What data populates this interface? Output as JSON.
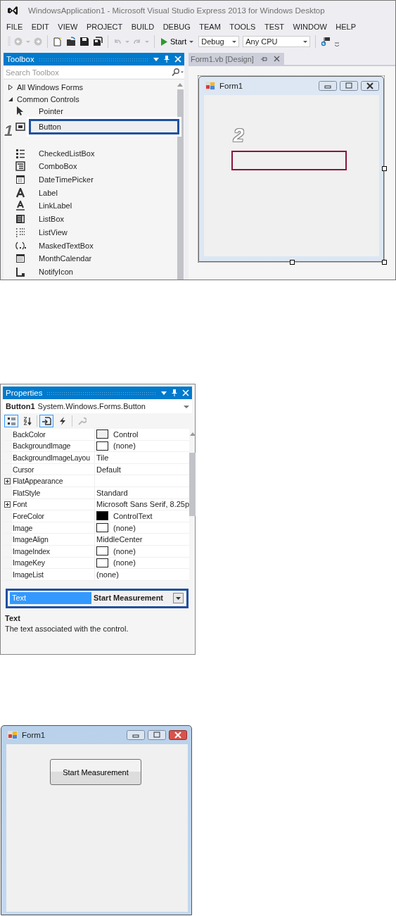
{
  "ide": {
    "title": "WindowsApplication1 - Microsoft Visual Studio Express 2013 for Windows Desktop",
    "menu": [
      "FILE",
      "EDIT",
      "VIEW",
      "PROJECT",
      "BUILD",
      "DEBUG",
      "TEAM",
      "TOOLS",
      "TEST",
      "WINDOW",
      "HELP"
    ],
    "toolbar": {
      "start": "Start",
      "configuration": "Debug",
      "platform": "Any CPU"
    },
    "toolbox": {
      "title": "Toolbox",
      "search_placeholder": "Search Toolbox",
      "callout": "1",
      "groups": [
        {
          "label": "All Windows Forms",
          "expanded": false
        },
        {
          "label": "Common Controls",
          "expanded": true
        }
      ],
      "items": [
        {
          "label": "Pointer",
          "kind": "pointer",
          "highlighted": false
        },
        {
          "label": "Button",
          "kind": "button",
          "highlighted": true
        },
        {
          "label": "CheckedListBox",
          "kind": "checkedlist",
          "highlighted": false
        },
        {
          "label": "ComboBox",
          "kind": "combo",
          "highlighted": false
        },
        {
          "label": "DateTimePicker",
          "kind": "datetime",
          "highlighted": false
        },
        {
          "label": "Label",
          "kind": "label",
          "highlighted": false
        },
        {
          "label": "LinkLabel",
          "kind": "linklabel",
          "highlighted": false
        },
        {
          "label": "ListBox",
          "kind": "listbox",
          "highlighted": false
        },
        {
          "label": "ListView",
          "kind": "listview",
          "highlighted": false
        },
        {
          "label": "MaskedTextBox",
          "kind": "masked",
          "highlighted": false
        },
        {
          "label": "MonthCalendar",
          "kind": "calendar",
          "highlighted": false
        },
        {
          "label": "NotifyIcon",
          "kind": "notify",
          "highlighted": false
        }
      ]
    },
    "document_tab": "Form1.vb [Design]",
    "design_form": {
      "title": "Form1",
      "callout": "2"
    }
  },
  "properties": {
    "title": "Properties",
    "object_name": "Button1",
    "object_type": "System.Windows.Forms.Button",
    "tools": [
      {
        "kind": "categorized",
        "selected": true
      },
      {
        "kind": "alphabetical",
        "selected": false
      },
      {
        "kind": "properties",
        "selected": true
      },
      {
        "kind": "events",
        "selected": false
      },
      {
        "kind": "pages",
        "selected": false
      }
    ],
    "rows": [
      {
        "name": "BackColor",
        "value": "Control",
        "color": "#f0f0f0",
        "expandable": false
      },
      {
        "name": "BackgroundImage",
        "value": "(none)",
        "color": "#ffffff",
        "expandable": false
      },
      {
        "name": "BackgroundImageLayou",
        "value": "Tile",
        "expandable": false
      },
      {
        "name": "Cursor",
        "value": "Default",
        "expandable": false
      },
      {
        "name": "FlatAppearance",
        "expandable": true
      },
      {
        "name": "FlatStyle",
        "value": "Standard",
        "expandable": false
      },
      {
        "name": "Font",
        "value": "Microsoft Sans Serif, 8.25p",
        "expandable": true
      },
      {
        "name": "ForeColor",
        "value": "ControlText",
        "color": "#000000",
        "expandable": false
      },
      {
        "name": "Image",
        "value": "(none)",
        "color": "#ffffff",
        "expandable": false
      },
      {
        "name": "ImageAlign",
        "value": "MiddleCenter",
        "expandable": false
      },
      {
        "name": "ImageIndex",
        "value": "(none)",
        "color": "#ffffff",
        "expandable": false
      },
      {
        "name": "ImageKey",
        "value": "(none)",
        "color": "#ffffff",
        "expandable": false
      },
      {
        "name": "ImageList",
        "value": "(none)",
        "expandable": false
      }
    ],
    "selected_row": {
      "name": "Text",
      "value": "Start Measurement",
      "selected": true
    },
    "description": {
      "title": "Text",
      "text": "The text associated with the control."
    }
  },
  "run_form": {
    "title": "Form1",
    "button": "Start Measurement"
  }
}
